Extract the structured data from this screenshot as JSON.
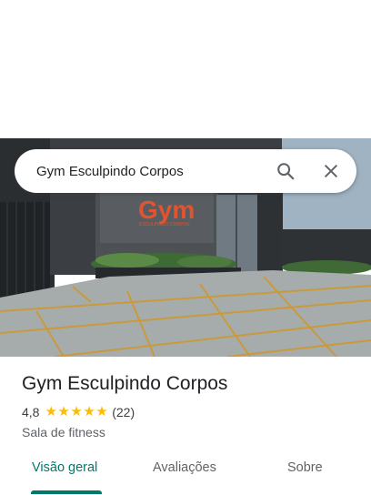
{
  "search": {
    "query": "Gym Esculpindo Corpos",
    "search_icon": "search-icon",
    "close_icon": "close-icon"
  },
  "hero": {
    "sign_text": "Gym",
    "sign_subtext": "ESCULPINDO CORPOS"
  },
  "place": {
    "name": "Gym Esculpindo Corpos",
    "rating": "4,8",
    "stars": 5,
    "review_count": "(22)",
    "category": "Sala de fitness"
  },
  "tabs": [
    {
      "label": "Visão geral",
      "active": true
    },
    {
      "label": "Avaliações",
      "active": false
    },
    {
      "label": "Sobre",
      "active": false
    }
  ],
  "colors": {
    "accent": "#00796b",
    "star": "#fbbc04"
  }
}
